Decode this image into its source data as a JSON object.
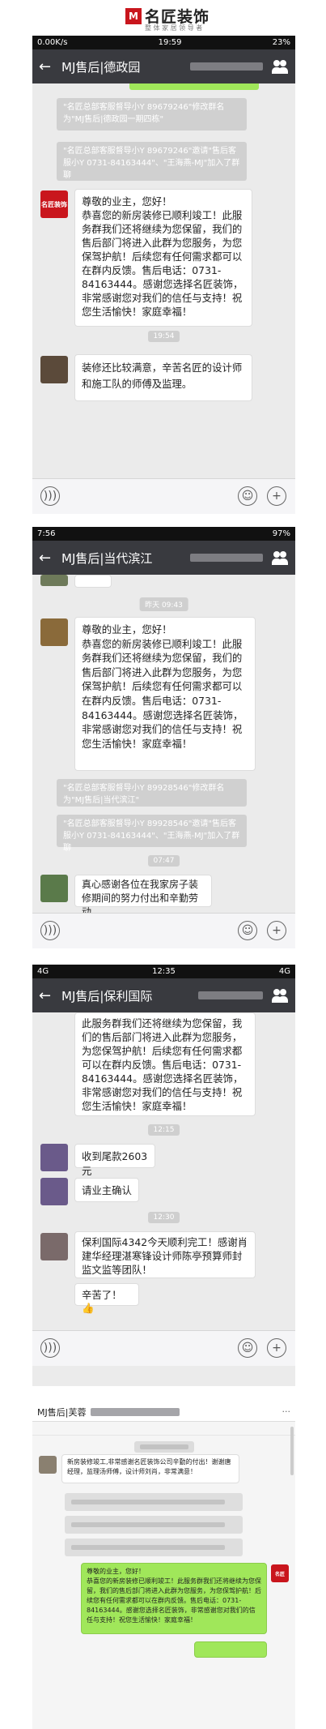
{
  "logo": {
    "mark": "M",
    "name": "名匠装饰",
    "slogan": "整 体 家 居 领 导 者"
  },
  "s1": {
    "status_left": "0.00K/s",
    "status_time": "19:59",
    "status_right": "23%",
    "title": "MJ售后|德政园",
    "sys1": "\"名匠总部客服督导小Y 89679246\"修改群名为\"MJ售后|德政园一期四栋\"",
    "sys2": "\"名匠总部客服督导小Y 89679246\"邀请\"售后客服小Y 0731-84163444\"、\"王海燕-MJ\"加入了群聊",
    "msg1": "尊敬的业主，您好！\n恭喜您的新房装修已顺利竣工！此服务群我们还将继续为您保留，我们的售后部门将进入此群为您服务，为您保驾护航！后续您有任何需求都可以在群内反馈。售后电话：0731-84163444。感谢您选择名匠装饰，非常感谢您对我们的信任与支持！祝您生活愉快！家庭幸福！",
    "time": "19:54",
    "msg2": "装修还比较满意，辛苦名匠的设计师和施工队的师傅及监理。"
  },
  "s2": {
    "status_left": "7:56",
    "status_right": "97%",
    "title": "MJ售后|当代滨江",
    "time1": "昨天 09:43",
    "msg1": "尊敬的业主，您好！\n恭喜您的新房装修已顺利竣工！此服务群我们还将继续为您保留，我们的售后部门将进入此群为您服务，为您保驾护航！后续您有任何需求都可以在群内反馈。售后电话：0731-84163444。感谢您选择名匠装饰，非常感谢您对我们的信任与支持！祝您生活愉快！家庭幸福！",
    "sys1": "\"名匠总部客服督导小Y 89928546\"修改群名为\"MJ售后|当代滨江\"",
    "sys2": "\"名匠总部客服督导小Y 89928546\"邀请\"售后客服小Y 0731-84163444\"、\"王海燕-MJ\"加入了群聊",
    "time2": "07:47",
    "msg2": "真心感谢各位在我家房子装修期间的努力付出和辛勤劳动。"
  },
  "s3": {
    "status_left": "4G",
    "status_time": "12:35",
    "status_right": "4G",
    "title": "MJ售后|保利国际",
    "msg1": "此服务群我们还将继续为您保留，我们的售后部门将进入此群为您服务，为您保驾护航！后续您有任何需求都可以在群内反馈。售后电话：0731-84163444。感谢您选择名匠装饰，非常感谢您对我们的信任与支持！祝您生活愉快！家庭幸福！",
    "time1": "12:15",
    "msg2": "收到尾款2603元",
    "msg3": "请业主确认",
    "time2": "12:30",
    "msg4": "保利国际4342今天顺利完工！感谢肖建华经理湛寒锋设计师陈亭预算师封监文监等团队！",
    "msg5": "辛苦了！👍"
  },
  "s4": {
    "title": "MJ售后|芙蓉",
    "msg1": "新房装修竣工,非常感谢名匠装饰公司辛勤的付出！谢谢唐经理，监理汤师傅，设计师刘肖，非常满意！",
    "msg2": "尊敬的业主，您好！\n恭喜您的新房装修已顺利竣工！此服务群我们还将继续为您保留，我们的售后部门将进入此群为您服务，为您保驾护航！后续您有任何需求都可以在群内反馈。售后电话：0731-84163444。感谢您选择名匠装饰，非常感谢您对我们的信任与支持！祝您生活愉快！家庭幸福！"
  }
}
